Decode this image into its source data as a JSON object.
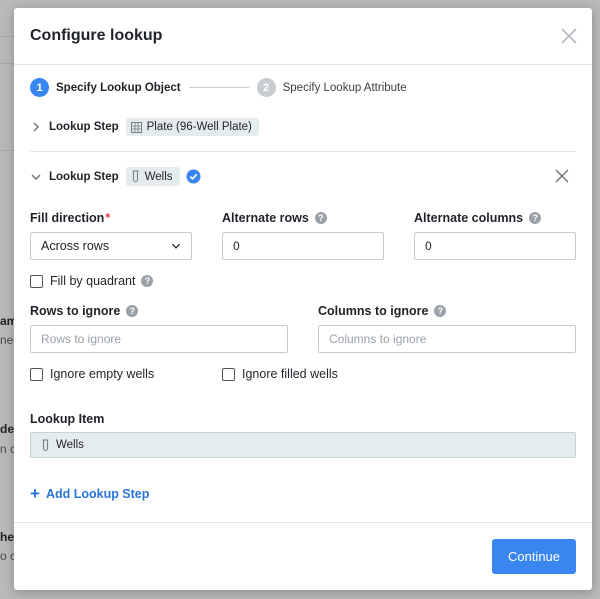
{
  "background": {
    "fragments": [
      {
        "text": "am",
        "bold": true
      },
      {
        "text": "nea",
        "bold": false
      },
      {
        "text": "de",
        "bold": true
      },
      {
        "text": "n c",
        "bold": false
      },
      {
        "text": "he",
        "bold": true
      },
      {
        "text": "o c",
        "bold": false
      }
    ]
  },
  "modal": {
    "title": "Configure lookup",
    "close_icon": "close-icon"
  },
  "stepper": {
    "steps": [
      {
        "number": "1",
        "label": "Specify Lookup Object",
        "state": "active"
      },
      {
        "number": "2",
        "label": "Specify Lookup Attribute",
        "state": "inactive"
      }
    ]
  },
  "lookup_steps": [
    {
      "label": "Lookup Step",
      "tag": "Plate (96-Well Plate)",
      "tag_icon": "plate-grid-icon",
      "expanded": false
    },
    {
      "label": "Lookup Step",
      "tag": "Wells",
      "tag_icon": "test-tube-icon",
      "expanded": true,
      "verified": true
    }
  ],
  "form": {
    "fill_direction": {
      "label": "Fill direction",
      "required_mark": "*",
      "value": "Across rows"
    },
    "alternate_rows": {
      "label": "Alternate rows",
      "value": "0"
    },
    "alternate_columns": {
      "label": "Alternate columns",
      "value": "0"
    },
    "fill_by_quadrant": {
      "label": "Fill by quadrant",
      "checked": false
    },
    "rows_to_ignore": {
      "label": "Rows to ignore",
      "placeholder": "Rows to ignore",
      "value": ""
    },
    "columns_to_ignore": {
      "label": "Columns to ignore",
      "placeholder": "Columns to ignore",
      "value": ""
    },
    "ignore_empty_wells": {
      "label": "Ignore empty wells",
      "checked": false
    },
    "ignore_filled_wells": {
      "label": "Ignore filled wells",
      "checked": false
    },
    "help_glyph": "?"
  },
  "lookup_item": {
    "label": "Lookup Item",
    "value": "Wells"
  },
  "add_step": {
    "plus": "+",
    "label": "Add Lookup Step"
  },
  "footer": {
    "continue_label": "Continue"
  },
  "colors": {
    "accent": "#3a86f0",
    "link": "#2a74d8",
    "required": "#e0434c",
    "tag_bg": "#e5ecee"
  }
}
